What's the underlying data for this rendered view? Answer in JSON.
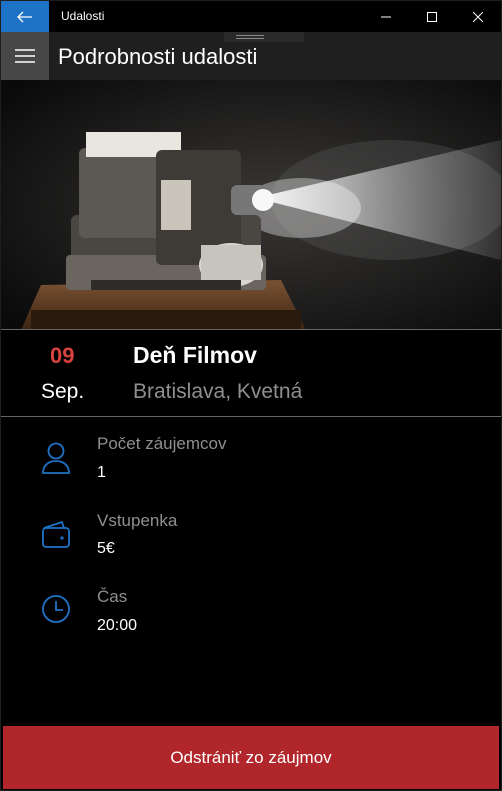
{
  "window": {
    "title": "Udalosti",
    "accent_color": "#1f73c6"
  },
  "appbar": {
    "page_title": "Podrobnosti udalosti"
  },
  "event": {
    "day": "09",
    "month": "Sep.",
    "title": "Deň Filmov",
    "place": "Bratislava, Kvetná",
    "day_color": "#d9433f"
  },
  "details": [
    {
      "icon": "person-icon",
      "label": "Počet záujemcov",
      "value": "1"
    },
    {
      "icon": "wallet-icon",
      "label": "Vstupenka",
      "value": "5€"
    },
    {
      "icon": "clock-icon",
      "label": "Čas",
      "value": "20:00"
    }
  ],
  "action": {
    "label": "Odstrániť zo záujmov",
    "color": "#b0262a"
  }
}
